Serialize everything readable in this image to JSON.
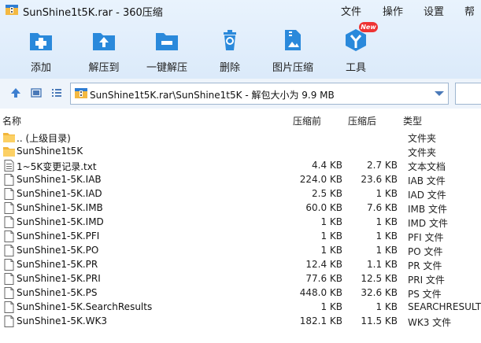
{
  "window": {
    "title": "SunShine1t5K.rar - 360压缩"
  },
  "menu": {
    "file": "文件",
    "operate": "操作",
    "settings": "设置",
    "help": "帮"
  },
  "toolbar": {
    "add": "添加",
    "extract_to": "解压到",
    "one_click_extract": "一键解压",
    "delete": "删除",
    "image_compress": "图片压缩",
    "tools": "工具",
    "new_badge": "New"
  },
  "address": {
    "path": "SunShine1t5K.rar\\SunShine1t5K - 解包大小为 9.9 MB"
  },
  "columns": {
    "name": "名称",
    "size": "压缩前",
    "compressed": "压缩后",
    "type": "类型"
  },
  "files": [
    {
      "name": ".. (上级目录)",
      "size": "",
      "compressed": "",
      "type": "文件夹",
      "icon": "folder-icon"
    },
    {
      "name": "SunShine1t5K",
      "size": "",
      "compressed": "",
      "type": "文件夹",
      "icon": "folder-icon"
    },
    {
      "name": "1~5K变更记录.txt",
      "size": "4.4 KB",
      "compressed": "2.7 KB",
      "type": "文本文档",
      "icon": "text-file-icon"
    },
    {
      "name": "SunShine1-5K.IAB",
      "size": "224.0 KB",
      "compressed": "23.6 KB",
      "type": "IAB 文件",
      "icon": "file-icon"
    },
    {
      "name": "SunShine1-5K.IAD",
      "size": "2.5 KB",
      "compressed": "1 KB",
      "type": "IAD 文件",
      "icon": "file-icon"
    },
    {
      "name": "SunShine1-5K.IMB",
      "size": "60.0 KB",
      "compressed": "7.6 KB",
      "type": "IMB 文件",
      "icon": "file-icon"
    },
    {
      "name": "SunShine1-5K.IMD",
      "size": "1 KB",
      "compressed": "1 KB",
      "type": "IMD 文件",
      "icon": "file-icon"
    },
    {
      "name": "SunShine1-5K.PFI",
      "size": "1 KB",
      "compressed": "1 KB",
      "type": "PFI 文件",
      "icon": "file-icon"
    },
    {
      "name": "SunShine1-5K.PO",
      "size": "1 KB",
      "compressed": "1 KB",
      "type": "PO 文件",
      "icon": "file-icon"
    },
    {
      "name": "SunShine1-5K.PR",
      "size": "12.4 KB",
      "compressed": "1.1 KB",
      "type": "PR 文件",
      "icon": "file-icon"
    },
    {
      "name": "SunShine1-5K.PRI",
      "size": "77.6 KB",
      "compressed": "12.5 KB",
      "type": "PRI 文件",
      "icon": "file-icon"
    },
    {
      "name": "SunShine1-5K.PS",
      "size": "448.0 KB",
      "compressed": "32.6 KB",
      "type": "PS 文件",
      "icon": "file-icon"
    },
    {
      "name": "SunShine1-5K.SearchResults",
      "size": "1 KB",
      "compressed": "1 KB",
      "type": "SEARCHRESULTS",
      "icon": "file-icon"
    },
    {
      "name": "SunShine1-5K.WK3",
      "size": "182.1 KB",
      "compressed": "11.5 KB",
      "type": "WK3 文件",
      "icon": "file-icon"
    }
  ]
}
